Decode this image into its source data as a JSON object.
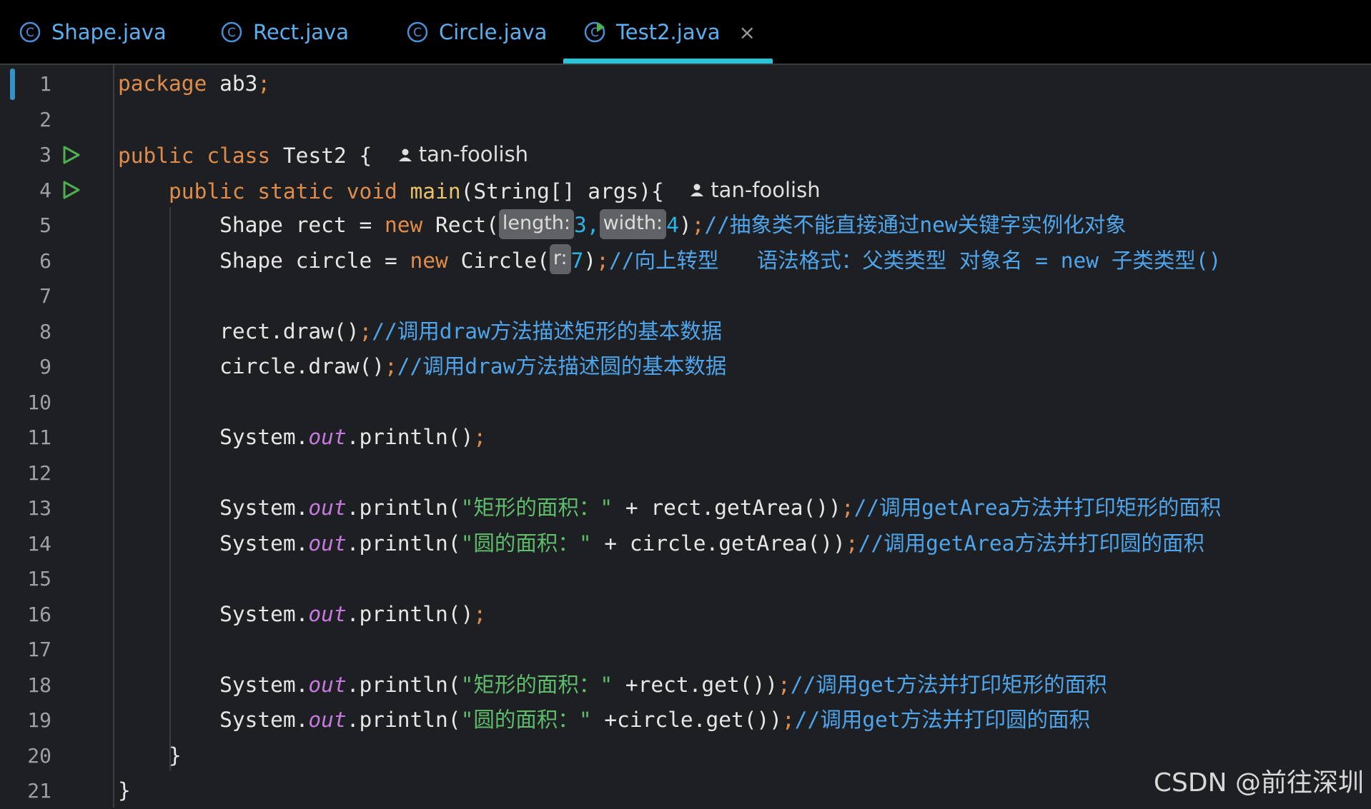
{
  "tabs": [
    {
      "label": "Shape.java",
      "icon": "class-icon",
      "active": false
    },
    {
      "label": "Rect.java",
      "icon": "class-icon",
      "active": false
    },
    {
      "label": "Circle.java",
      "icon": "class-icon",
      "active": false
    },
    {
      "label": "Test2.java",
      "icon": "runnable-class-icon",
      "active": true,
      "close": "×"
    }
  ],
  "colors": {
    "background": "#1e1f22",
    "keyword": "#e08c4b",
    "method": "#e8c36a",
    "static_field": "#c67adf",
    "string": "#5dbd6b",
    "comment": "#4fa5ec",
    "number": "#2ab4e6",
    "tab_text": "#5ab0f0",
    "active_tab_underline": "#2bc4d8",
    "run_icon": "#4caf50"
  },
  "line_numbers": [
    "1",
    "2",
    "3",
    "4",
    "5",
    "6",
    "7",
    "8",
    "9",
    "10",
    "11",
    "12",
    "13",
    "14",
    "15",
    "16",
    "17",
    "18",
    "19",
    "20",
    "21"
  ],
  "code": {
    "l1": {
      "kw": "package",
      "rest": " ab3",
      "semi": ";"
    },
    "l3": {
      "kw1": "public",
      "kw2": "class",
      "rest": " Test2 {",
      "author": "tan-foolish"
    },
    "l4": {
      "kw1": "public",
      "kw2": "static",
      "kw3": "void",
      "fn": "main",
      "rest": "(String[] args){",
      "author": "tan-foolish"
    },
    "l5": {
      "a": "Shape rect = ",
      "kw": "new",
      "b": " Rect(",
      "hint1": "length:",
      "n1": "3",
      "comma": ",",
      "hint2": "width:",
      "n2": "4",
      "c": ")",
      "semi": ";",
      "cmt": "//抽象类不能直接通过new关键字实例化对象"
    },
    "l6": {
      "a": "Shape circle = ",
      "kw": "new",
      "b": " Circle(",
      "hint1": "r:",
      "n1": "7",
      "c": ")",
      "semi": ";",
      "cmt": "//向上转型   语法格式：父类类型 对象名 = new 子类类型()"
    },
    "l8": {
      "a": "rect.draw()",
      "semi": ";",
      "cmt": "//调用draw方法描述矩形的基本数据"
    },
    "l9": {
      "a": "circle.draw()",
      "semi": ";",
      "cmt": "//调用draw方法描述圆的基本数据"
    },
    "l11": {
      "a": "System.",
      "field": "out",
      "b": ".println()",
      "semi": ";"
    },
    "l13": {
      "a": "System.",
      "field": "out",
      "b": ".println(",
      "str": "\"矩形的面积：\"",
      "c": " + rect.getArea())",
      "semi": ";",
      "cmt": "//调用getArea方法并打印矩形的面积"
    },
    "l14": {
      "a": "System.",
      "field": "out",
      "b": ".println(",
      "str": "\"圆的面积：\"",
      "c": " + circle.getArea())",
      "semi": ";",
      "cmt": "//调用getArea方法并打印圆的面积"
    },
    "l16": {
      "a": "System.",
      "field": "out",
      "b": ".println()",
      "semi": ";"
    },
    "l18": {
      "a": "System.",
      "field": "out",
      "b": ".println(",
      "str": "\"矩形的面积：\"",
      "c": " +rect.get())",
      "semi": ";",
      "cmt": "//调用get方法并打印矩形的面积"
    },
    "l19": {
      "a": "System.",
      "field": "out",
      "b": ".println(",
      "str": "\"圆的面积：\"",
      "c": " +circle.get())",
      "semi": ";",
      "cmt": "//调用get方法并打印圆的面积"
    },
    "l20": {
      "a": "}"
    },
    "l21": {
      "a": "}"
    }
  },
  "watermark": "CSDN @前往深圳"
}
